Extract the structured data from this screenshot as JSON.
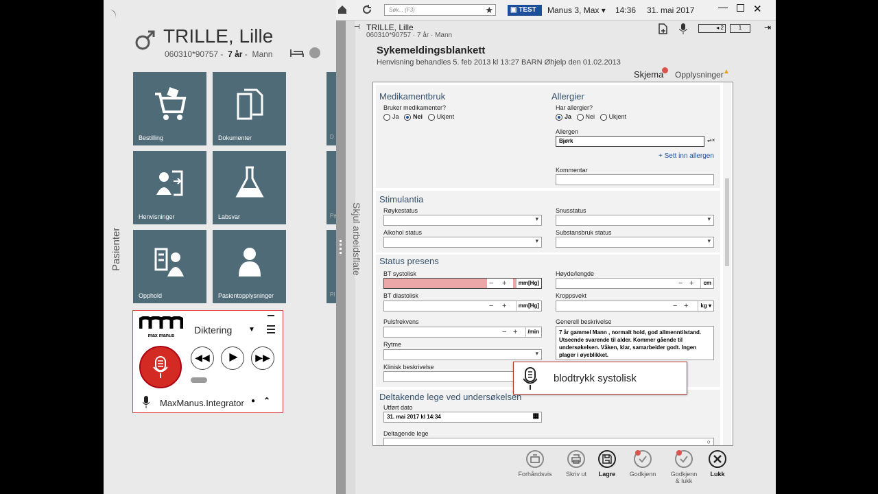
{
  "patient": {
    "name": "TRILLE, Lille",
    "id": "060310*90757",
    "age": "7 år",
    "gender": "Mann"
  },
  "sidebar": {
    "vertical_label": "Pasienter"
  },
  "workspace": {
    "hide_label": "Skjul arbeidsflate"
  },
  "tiles": [
    {
      "label": "Bestilling"
    },
    {
      "label": "Dokumenter"
    },
    {
      "label": "Henvisninger"
    },
    {
      "label": "Labsvar"
    },
    {
      "label": "Opphold"
    },
    {
      "label": "Pasientopplysninger"
    }
  ],
  "partial_tiles": [
    "D",
    "Pa",
    "Pl"
  ],
  "dictation": {
    "logo": "max manus",
    "mode": "Diktering",
    "integrator": "MaxManus.Integrator"
  },
  "topbar": {
    "search_placeholder": "Søk... (F3)",
    "env": "TEST",
    "user": "Manus 3, Max",
    "time": "14:36",
    "date": "31. mai 2017"
  },
  "header": {
    "patient_name": "TRILLE, Lille",
    "patient_sub": "060310*90757 · 7 år · Mann",
    "page_one": "1",
    "page_two": "2"
  },
  "form": {
    "title": "Sykemeldingsblankett",
    "subtitle": "Henvisning behandles 5. feb 2013 kl 13:27 BARN Øhjelp den 01.02.2013",
    "tab_schema": "Skjema",
    "tab_info": "Opplysninger",
    "medikament": {
      "title": "Medikamentbruk",
      "question": "Bruker medikamenter?",
      "options": [
        "Ja",
        "Nei",
        "Ukjent"
      ],
      "selected": "Nei"
    },
    "allergi": {
      "title": "Allergier",
      "question": "Har allergier?",
      "options": [
        "Ja",
        "Nei",
        "Ukjent"
      ],
      "selected": "Ja",
      "allergen_label": "Allergen",
      "allergen_value": "Bjørk",
      "add_link": "+ Sett inn allergen",
      "comment_label": "Kommentar"
    },
    "stimulantia": {
      "title": "Stimulantia",
      "royk": "Røykestatus",
      "snus": "Snusstatus",
      "alkohol": "Alkohol status",
      "substans": "Substansbruk status"
    },
    "status": {
      "title": "Status presens",
      "bt_sys": "BT systolisk",
      "bt_sys_unit": "mm[Hg]",
      "bt_dia": "BT diastolisk",
      "bt_dia_unit": "mm[Hg]",
      "hoyde": "Høyde/lengde",
      "hoyde_unit": "cm",
      "vekt": "Kroppsvekt",
      "vekt_unit": "kg",
      "puls": "Pulsfrekvens",
      "puls_unit": "/min",
      "rytme": "Rytme",
      "klinisk": "Klinisk beskrivelse",
      "generell": "Generell beskrivelse",
      "generell_text": "7 år gammel Mann , normalt hold, god allmenntilstand. Utseende svarende til alder. Kommer gående til undersøkelsen. Våken, klar, samarbeider godt. Ingen plager i øyeblikket."
    },
    "deltakende": {
      "title": "Deltakende lege ved undersøkelsen",
      "dato_label": "Utført dato",
      "dato_value": "31. mai 2017 kl 14:34",
      "lege_label": "Deltagende lege"
    }
  },
  "voice_popup": {
    "text": "blodtrykk systolisk"
  },
  "actions": [
    {
      "label": "Forhåndsvis"
    },
    {
      "label": "Skriv ut"
    },
    {
      "label": "Lagre"
    },
    {
      "label": "Godkjenn"
    },
    {
      "label": "Godkjenn\n& lukk"
    },
    {
      "label": "Lukk"
    }
  ],
  "colors": {
    "tile": "#4f6b77",
    "highlight_field": "#eba7a7",
    "mic_red": "#d42a24",
    "accent_blue": "#1c4e9c"
  }
}
